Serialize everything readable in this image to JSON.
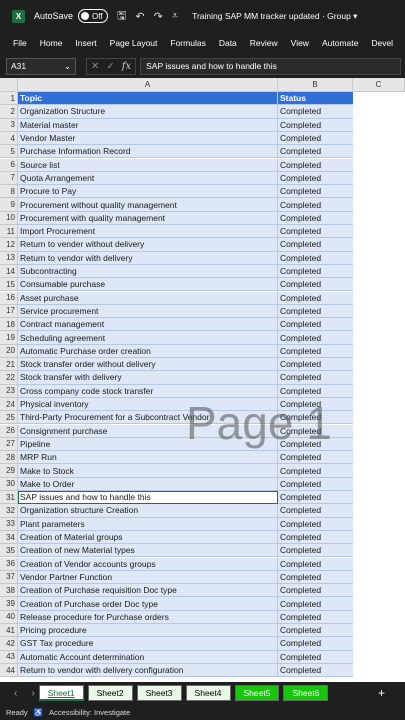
{
  "titlebar": {
    "autosave_label": "AutoSave",
    "autosave_state": "Off",
    "doc_title": "Training SAP MM tracker updated  ·  Group  ▾"
  },
  "menu": [
    "File",
    "Home",
    "Insert",
    "Page Layout",
    "Formulas",
    "Data",
    "Review",
    "View",
    "Automate",
    "Devel"
  ],
  "formula": {
    "name_box": "A31",
    "content": "SAP issues and how to handle this"
  },
  "columns": [
    "A",
    "B",
    "C"
  ],
  "rows": [
    {
      "n": "1",
      "topic": "Topic",
      "status": "Status"
    },
    {
      "n": "2",
      "topic": "Organization Structure",
      "status": "Completed"
    },
    {
      "n": "3",
      "topic": "Material master",
      "status": "Completed"
    },
    {
      "n": "4",
      "topic": "Vendor Master",
      "status": "Completed"
    },
    {
      "n": "5",
      "topic": "Purchase Information Record",
      "status": "Completed"
    },
    {
      "n": "6",
      "topic": "Source list",
      "status": "Completed"
    },
    {
      "n": "7",
      "topic": "Quota Arrangement",
      "status": "Completed"
    },
    {
      "n": "8",
      "topic": "Procure to Pay",
      "status": "Completed"
    },
    {
      "n": "9",
      "topic": "Procurement without quality management",
      "status": "Completed"
    },
    {
      "n": "10",
      "topic": "Procurement with quality management",
      "status": "Completed"
    },
    {
      "n": "11",
      "topic": "Import Procurement",
      "status": "Completed"
    },
    {
      "n": "12",
      "topic": "Return to vender without delivery",
      "status": "Completed"
    },
    {
      "n": "13",
      "topic": "Return to vendor with delivery",
      "status": "Completed"
    },
    {
      "n": "14",
      "topic": "Subcontracting",
      "status": "Completed"
    },
    {
      "n": "15",
      "topic": "Consumable purchase",
      "status": "Completed"
    },
    {
      "n": "16",
      "topic": "Asset purchase",
      "status": "Completed"
    },
    {
      "n": "17",
      "topic": "Service procurement",
      "status": "Completed"
    },
    {
      "n": "18",
      "topic": "Contract management",
      "status": "Completed"
    },
    {
      "n": "19",
      "topic": "Scheduling agreement",
      "status": "Completed"
    },
    {
      "n": "20",
      "topic": "Automatic Purchase order creation",
      "status": "Completed"
    },
    {
      "n": "21",
      "topic": "Stock transfer order without delivery",
      "status": "Completed"
    },
    {
      "n": "22",
      "topic": "Stock transfer with delivery",
      "status": "Completed"
    },
    {
      "n": "23",
      "topic": "Cross company code stock transfer",
      "status": "Completed"
    },
    {
      "n": "24",
      "topic": "Physical inventory",
      "status": "Completed"
    },
    {
      "n": "25",
      "topic": "Third-Party Procurement for a Subcontract Vendor",
      "status": "Completed"
    },
    {
      "n": "26",
      "topic": "Consignment purchase",
      "status": "Completed"
    },
    {
      "n": "27",
      "topic": "Pipeline",
      "status": "Completed"
    },
    {
      "n": "28",
      "topic": "MRP Run",
      "status": "Completed"
    },
    {
      "n": "29",
      "topic": "Make to Stock",
      "status": "Completed"
    },
    {
      "n": "30",
      "topic": "Make to Order",
      "status": "Completed"
    },
    {
      "n": "31",
      "topic": "SAP issues and how to handle this",
      "status": "Completed"
    },
    {
      "n": "32",
      "topic": "Organization structure Creation",
      "status": "Completed"
    },
    {
      "n": "33",
      "topic": "Plant parameters",
      "status": "Completed"
    },
    {
      "n": "34",
      "topic": "Creation of Material groups",
      "status": "Completed"
    },
    {
      "n": "35",
      "topic": "Creation of new Material types",
      "status": "Completed"
    },
    {
      "n": "36",
      "topic": "Creation of Vendor accounts groups",
      "status": "Completed"
    },
    {
      "n": "37",
      "topic": "Vendor Partner Function",
      "status": "Completed"
    },
    {
      "n": "38",
      "topic": "Creation of Purchase requisition Doc type",
      "status": "Completed"
    },
    {
      "n": "39",
      "topic": "Creation of Purchase order Doc type",
      "status": "Completed"
    },
    {
      "n": "40",
      "topic": "Release procedure for Purchase orders",
      "status": "Completed"
    },
    {
      "n": "41",
      "topic": "Pricing procedure",
      "status": "Completed"
    },
    {
      "n": "42",
      "topic": "GST Tax procedure",
      "status": "Completed"
    },
    {
      "n": "43",
      "topic": "Automatic Account determination",
      "status": "Completed"
    },
    {
      "n": "44",
      "topic": "Return to vendor with delivery configuration",
      "status": "Completed"
    }
  ],
  "selected_row": "31",
  "watermark": "Page 1",
  "tabs": [
    {
      "label": "Sheet1",
      "style": "active"
    },
    {
      "label": "Sheet2",
      "style": "light"
    },
    {
      "label": "Sheet3",
      "style": "light"
    },
    {
      "label": "Sheet4",
      "style": "light"
    },
    {
      "label": "Sheet5",
      "style": "green"
    },
    {
      "label": "Sheet6",
      "style": "green"
    }
  ],
  "status": {
    "ready": "Ready",
    "accessibility": "Accessibility: Investigate"
  }
}
